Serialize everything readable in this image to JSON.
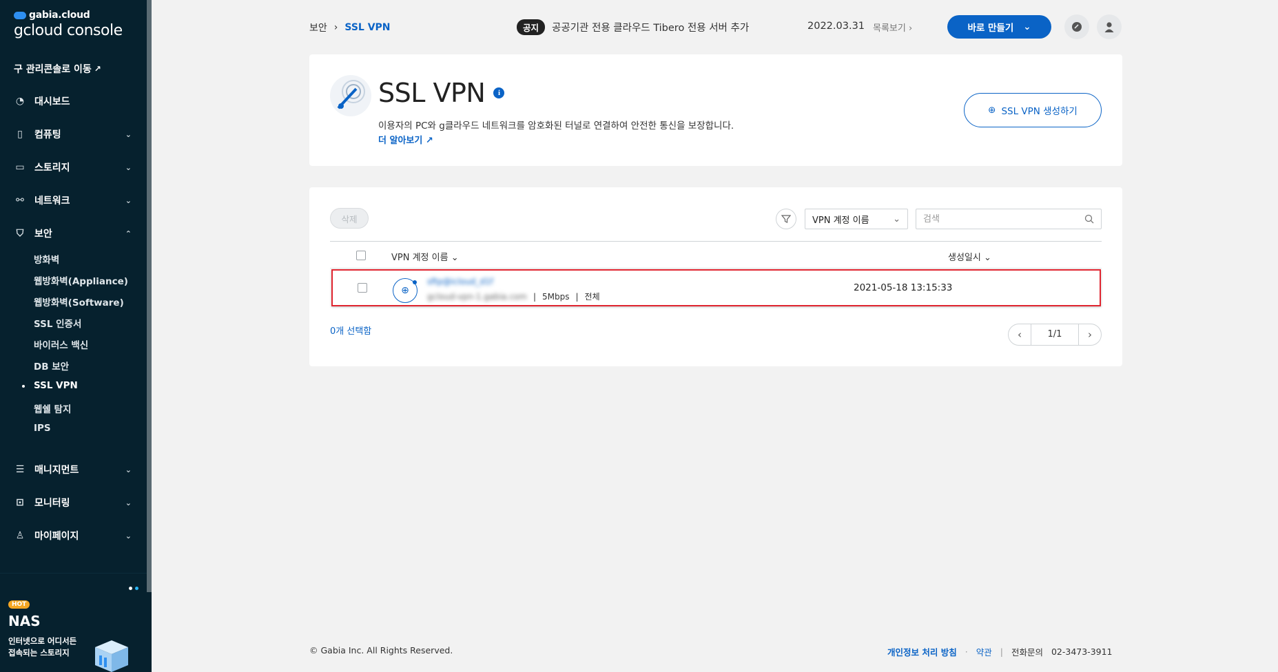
{
  "sidebar": {
    "brand_small": "gabia.cloud",
    "brand_big": "gcloud console",
    "legacy_link": "구 관리콘솔로 이동",
    "items": [
      {
        "label": "대시보드",
        "icon": "dashboard-icon"
      },
      {
        "label": "컴퓨팅",
        "icon": "cpu-icon"
      },
      {
        "label": "스토리지",
        "icon": "storage-icon"
      },
      {
        "label": "네트워크",
        "icon": "network-icon"
      },
      {
        "label": "보안",
        "icon": "shield-icon"
      },
      {
        "label": "매니지먼트",
        "icon": "management-icon"
      },
      {
        "label": "모니터링",
        "icon": "monitoring-icon"
      },
      {
        "label": "마이페이지",
        "icon": "user-icon"
      }
    ],
    "security_sub": [
      "방화벽",
      "웹방화벽(Appliance)",
      "웹방화벽(Software)",
      "SSL 인증서",
      "바이러스 백신",
      "DB 보안",
      "SSL VPN",
      "웹쉘 탐지",
      "IPS"
    ],
    "active_sub": "SSL VPN",
    "promo": {
      "tag": "HOT",
      "title": "NAS",
      "line1": "인터넷으로 어디서든",
      "line2": "접속되는 스토리지"
    }
  },
  "topbar": {
    "breadcrumb_parent": "보안",
    "breadcrumb_current": "SSL VPN",
    "notice_tag": "공지",
    "notice_text": "공공기관 전용 클라우드 Tibero 전용 서버 추가",
    "notice_date": "2022.03.31",
    "notice_list": "목록보기",
    "create_label": "바로 만들기"
  },
  "header": {
    "title": "SSL VPN",
    "description": "이용자의 PC와 g클라우드 네트워크를 암호화된 터널로 연결하여 안전한 통신을 보장합니다.",
    "learn_more": "더 알아보기",
    "create_button": "SSL VPN 생성하기"
  },
  "table": {
    "delete_label": "삭제",
    "filter_select": "VPN 계정 이름",
    "search_placeholder": "검색",
    "columns": [
      "VPN 계정 이름",
      "생성일시"
    ],
    "rows": [
      {
        "name": "sftp@icloud_d1f",
        "host": "gcloud-vpn-1.gabia.com",
        "speed": "5Mbps",
        "scope": "전체",
        "created": "2021-05-18 13:15:33"
      }
    ],
    "selected_count": "0개 선택함",
    "page": "1/1"
  },
  "footer": {
    "copyright": "© Gabia Inc. All Rights Reserved.",
    "privacy": "개인정보 처리 방침",
    "terms": "약관",
    "phone_label": "전화문의",
    "phone": "02-3473-3911"
  },
  "colors": {
    "sidebar_bg": "#06212e",
    "accent": "#0a63c6",
    "highlight": "#e0242f"
  }
}
